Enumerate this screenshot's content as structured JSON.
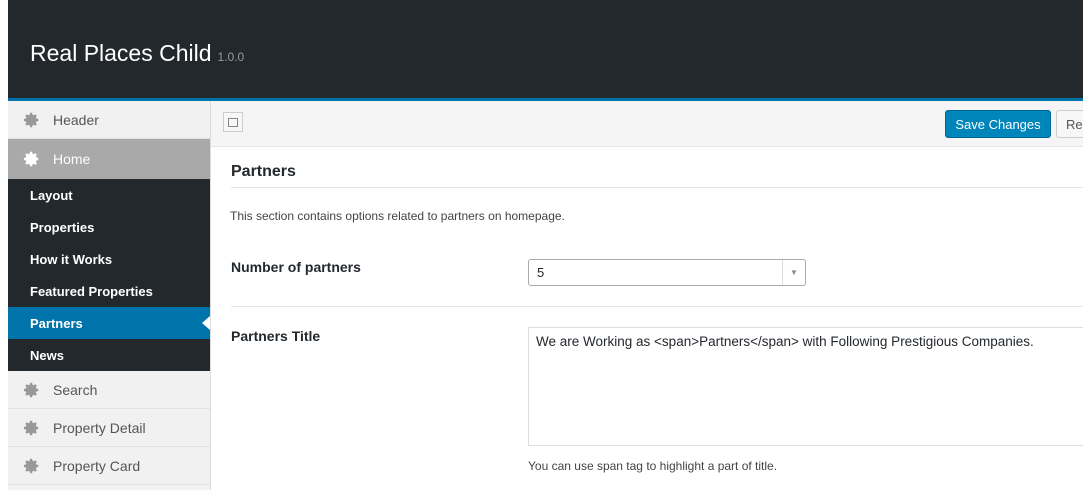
{
  "header": {
    "title": "Real Places Child",
    "version": "1.0.0"
  },
  "sidebar": {
    "sections_top": [
      {
        "label": "Header",
        "icon": "gear-icon"
      },
      {
        "label": "Home",
        "icon": "gear-icon",
        "active": true
      }
    ],
    "home_items": [
      "Layout",
      "Properties",
      "How it Works",
      "Featured Properties",
      "Partners",
      "News"
    ],
    "active_item": "Partners",
    "sections_bottom": [
      {
        "label": "Search",
        "icon": "gear-icon"
      },
      {
        "label": "Property Detail",
        "icon": "gear-icon"
      },
      {
        "label": "Property Card",
        "icon": "gear-icon"
      }
    ]
  },
  "toolbar": {
    "save_label": "Save Changes",
    "reset_label": "Res"
  },
  "section": {
    "title": "Partners",
    "description": "This section contains options related to partners on homepage.",
    "number_label": "Number of partners",
    "number_value": "5",
    "title_label": "Partners Title",
    "title_value": "We are Working as <span>Partners</span> with Following Prestigious Companies.",
    "title_help": "You can use span tag to highlight a part of title."
  },
  "colors": {
    "accent": "#0073aa",
    "dark": "#23282d",
    "button": "#0085ba"
  }
}
